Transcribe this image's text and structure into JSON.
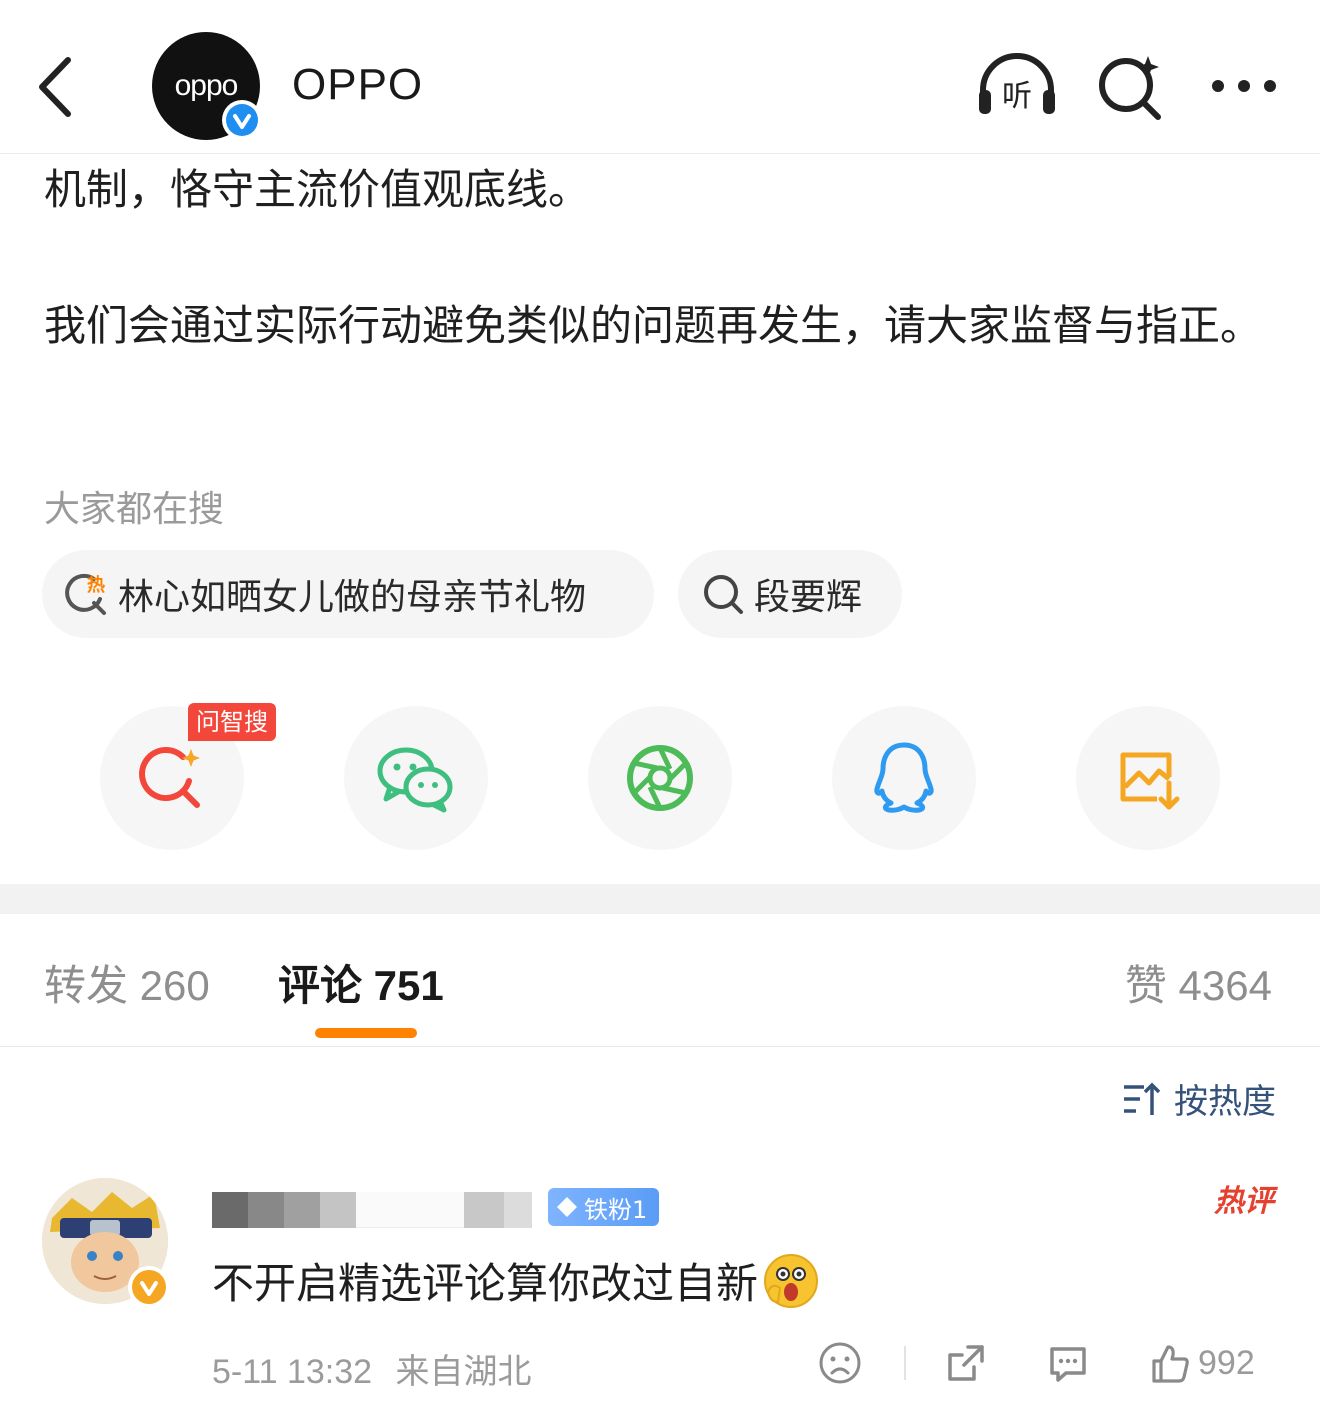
{
  "header": {
    "account_name": "OPPO",
    "avatar_logo_text": "oppo",
    "listen_label": "听"
  },
  "post": {
    "line_1": "机制，恪守主流价值观底线。",
    "para_2": "我们会通过实际行动避免类似的问题再发生，请大家监督与指正。"
  },
  "hot_search": {
    "title": "大家都在搜",
    "chips": [
      {
        "icon": "hot-search-icon",
        "hot_label": "热",
        "label": "林心如晒女儿做的母亲节礼物"
      },
      {
        "icon": "search-icon",
        "label": "段要辉"
      }
    ]
  },
  "share": {
    "ask_badge": "问智搜",
    "targets": [
      {
        "icon": "ai-search-icon",
        "color": "#f2473a"
      },
      {
        "icon": "wechat-icon",
        "color": "#3fbf7f"
      },
      {
        "icon": "moments-icon",
        "color": "#4cbb58"
      },
      {
        "icon": "qq-icon",
        "color": "#2f9bf0"
      },
      {
        "icon": "save-image-icon",
        "color": "#f5a623"
      }
    ]
  },
  "tabs": {
    "repost": "转发 260",
    "comments": "评论 751",
    "likes": "赞 4364",
    "accent": "#ff8200"
  },
  "sort": {
    "label": "按热度"
  },
  "comment": {
    "fan_badge": "铁粉1",
    "hot_tag": "热评",
    "text": "不开启精选评论算你改过自新",
    "time": "5-11 13:32",
    "location": "来自湖北",
    "like_count": "992"
  }
}
